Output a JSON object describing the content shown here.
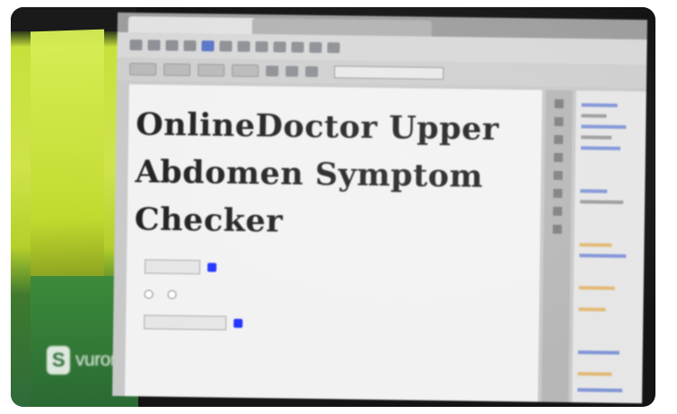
{
  "desktop": {
    "brand": "vurons",
    "brand_mark": "S"
  },
  "page": {
    "title": "OnlineDoctor Upper Abdomen Symptom Checker",
    "intro": "",
    "form": {
      "dob_label": "",
      "gender_label": "",
      "male_label": "",
      "female_label": "",
      "age_label": ""
    }
  },
  "colors": {
    "desktop_green": "#c7e13a",
    "calendar_button": "#2233ff"
  },
  "icons": [
    "calendar-icon",
    "logo-icon"
  ]
}
